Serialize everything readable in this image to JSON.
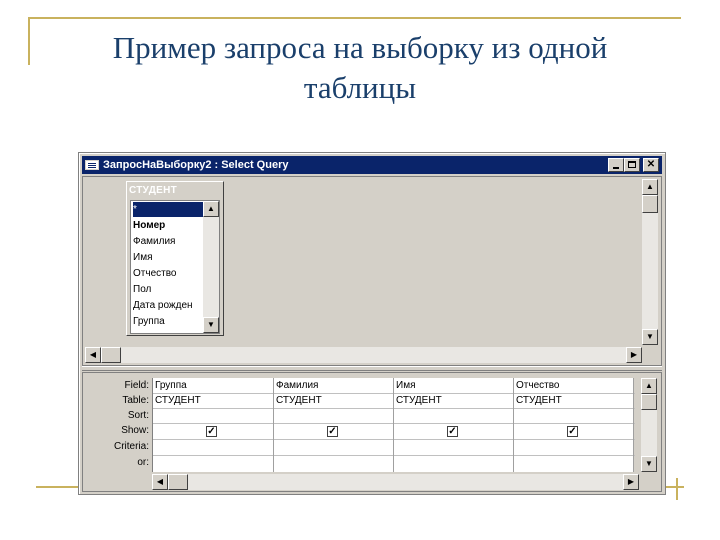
{
  "slide": {
    "title_line1": "Пример запроса на выборку из одной",
    "title_line2": "таблицы"
  },
  "window": {
    "title": "ЗапросНаВыборку2 : Select Query",
    "controls": [
      "minimize-icon",
      "maximize-icon",
      "close-icon"
    ]
  },
  "field_list": {
    "table_name": "СТУДЕНТ",
    "fields": [
      "*",
      "Номер",
      "Фамилия",
      "Имя",
      "Отчество",
      "Пол",
      "Дата рожден",
      "Группа"
    ]
  },
  "grid": {
    "row_labels": {
      "field": "Field:",
      "table": "Table:",
      "sort": "Sort:",
      "show": "Show:",
      "criteria": "Criteria:",
      "or": "or:"
    },
    "columns": [
      {
        "field": "Группа",
        "table": "СТУДЕНТ",
        "show": true
      },
      {
        "field": "Фамилия",
        "table": "СТУДЕНТ",
        "show": true
      },
      {
        "field": "Имя",
        "table": "СТУДЕНТ",
        "show": true
      },
      {
        "field": "Отчество",
        "table": "СТУДЕНТ",
        "show": true
      }
    ]
  },
  "icons": {
    "check_glyph": "✓",
    "arrow_up": "▲",
    "arrow_down": "▼",
    "arrow_left": "◀",
    "arrow_right": "▶"
  },
  "colors": {
    "title_bar": "#0a246a",
    "window_face": "#d4d0c8",
    "slide_title": "#1a3f6b",
    "slide_accent": "#c9b25e"
  }
}
